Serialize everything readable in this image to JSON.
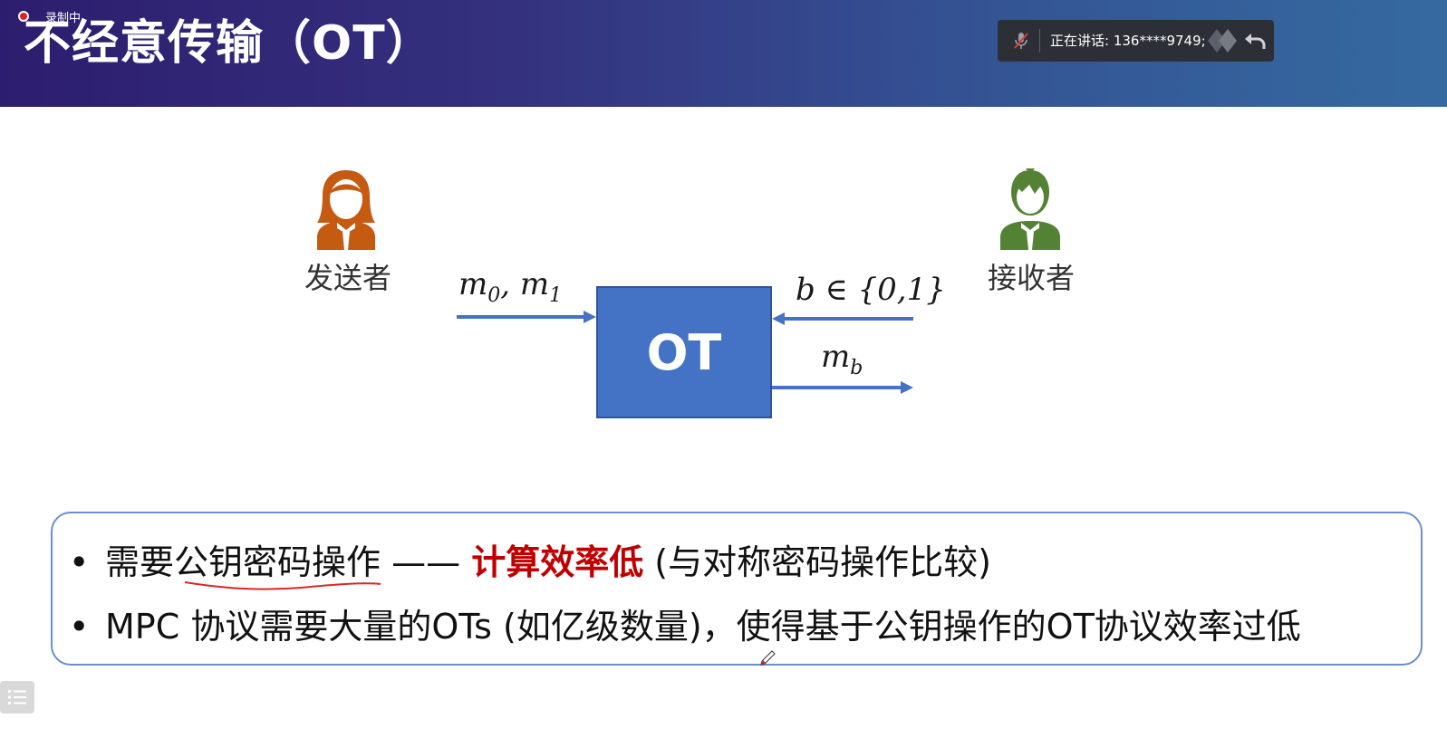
{
  "recording": {
    "label": "录制中"
  },
  "title": "不经意传输（OT）",
  "speaker_bar": {
    "text": "正在讲话: 136****9749;",
    "icons": [
      "mic-muted-icon",
      "speaker-avatars-icon",
      "undo-icon"
    ]
  },
  "diagram": {
    "sender_label": "发送者",
    "receiver_label": "接收者",
    "box_label": "OT",
    "input_left": {
      "m": "m",
      "sub0": "0",
      "comma": ", ",
      "sub1": "1"
    },
    "input_right": "b ∈ {0,1}",
    "output": {
      "m": "m",
      "sub": "b"
    }
  },
  "bullets": {
    "b1": {
      "dot": "•",
      "pre": "需要",
      "underlined": "公钥密码操作",
      "dash": " —— ",
      "highlight": "计算效率低",
      "post": " (与对称密码操作比较)"
    },
    "b2": {
      "dot": "•",
      "text": "MPC 协议需要大量的OTs (如亿级数量)，使得基于公钥操作的OT协议效率过低"
    }
  },
  "colors": {
    "sender": "#c55a11",
    "receiver": "#548235",
    "box": "#4472c4",
    "arrow": "#4472c4",
    "highlight": "#c00000",
    "border": "#6b8fc9"
  }
}
